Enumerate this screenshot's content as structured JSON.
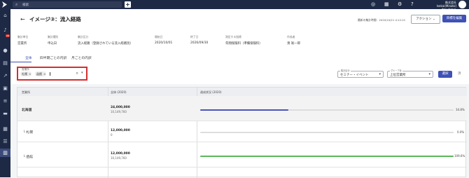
{
  "topbar": {
    "search_placeholder": "検索",
    "plus": "+",
    "company_name": "株式会社Isekai(Minato)",
    "user_name": "中川 なつみ"
  },
  "sidebar": {
    "badge": "10"
  },
  "header": {
    "back": "←",
    "title": "イメージ③：流入経路",
    "updated": "最新の集計時間：2020/10/21 4:12:22",
    "action_label": "アクション ⌄",
    "edit_label": "目標を編集"
  },
  "meta": [
    {
      "label": "集計単位",
      "value": "営業所"
    },
    {
      "label": "集計種別",
      "value": "申込日"
    },
    {
      "label": "集計区分",
      "value": "流入経路（登録されている流入経路別）"
    },
    {
      "label": "開始日",
      "value": "2020/10/01"
    },
    {
      "label": "終了日",
      "value": "2026/09/30"
    },
    {
      "label": "測定する指標",
      "value": "年間保険料（準備保険料）"
    },
    {
      "label": "作成者",
      "value": "湊 咲一郎"
    }
  ],
  "tabs": [
    "全体",
    "四半期ごとの内訳",
    "月ごとの内訳"
  ],
  "filter": {
    "label": "営業所",
    "chips": [
      "札幌",
      "函館"
    ],
    "clear": "×",
    "caret": "▾"
  },
  "selects": [
    {
      "label": "集計区分",
      "value": "セミナー・イベント"
    },
    {
      "label": "グループ化",
      "value": "上位営業所"
    }
  ],
  "buttons": {
    "select": "選択",
    "extra": "済"
  },
  "table": {
    "headers": [
      "営業所",
      "全体 (2020)",
      "達成状況 (2020)"
    ],
    "rows": [
      {
        "name": "北海道",
        "bold": true,
        "v1": "24,000,000",
        "v2": "10,149,760",
        "pct": "34.8%",
        "progress": 0.348,
        "color": "#4a55b8"
      },
      {
        "name": "└ 札幌",
        "bold": false,
        "v1": "12,000,000",
        "v2": "0",
        "pct": "0.0%",
        "progress": 0.0,
        "color": "#4a55b8"
      },
      {
        "name": "└ 函館",
        "bold": false,
        "v1": "12,000,000",
        "v2": "10,149,760",
        "pct": "109.6%",
        "progress": 1.0,
        "color": "#5cb85c"
      }
    ]
  }
}
